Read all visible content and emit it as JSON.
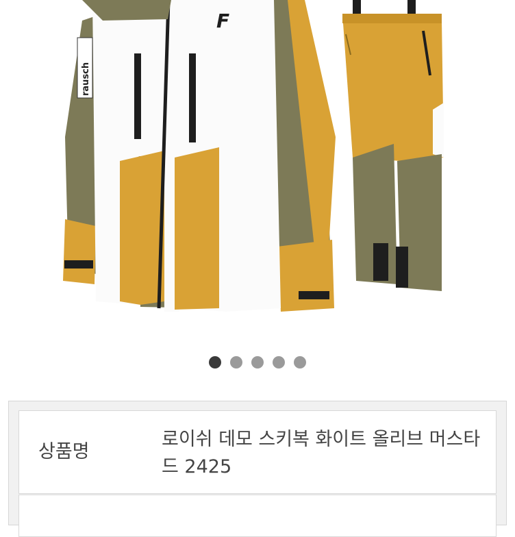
{
  "gallery": {
    "logo_text": "F",
    "sleeve_brand": "rausch",
    "dots_total": 5,
    "active_index": 0,
    "colors": {
      "olive": "#7d7a57",
      "mustard": "#d9a235",
      "white": "#fbfbfb",
      "black": "#1e1e1e"
    }
  },
  "product_info": {
    "label": "상품명",
    "value": "로이쉬 데모 스키복 화이트 올리브 머스타드 2425"
  }
}
